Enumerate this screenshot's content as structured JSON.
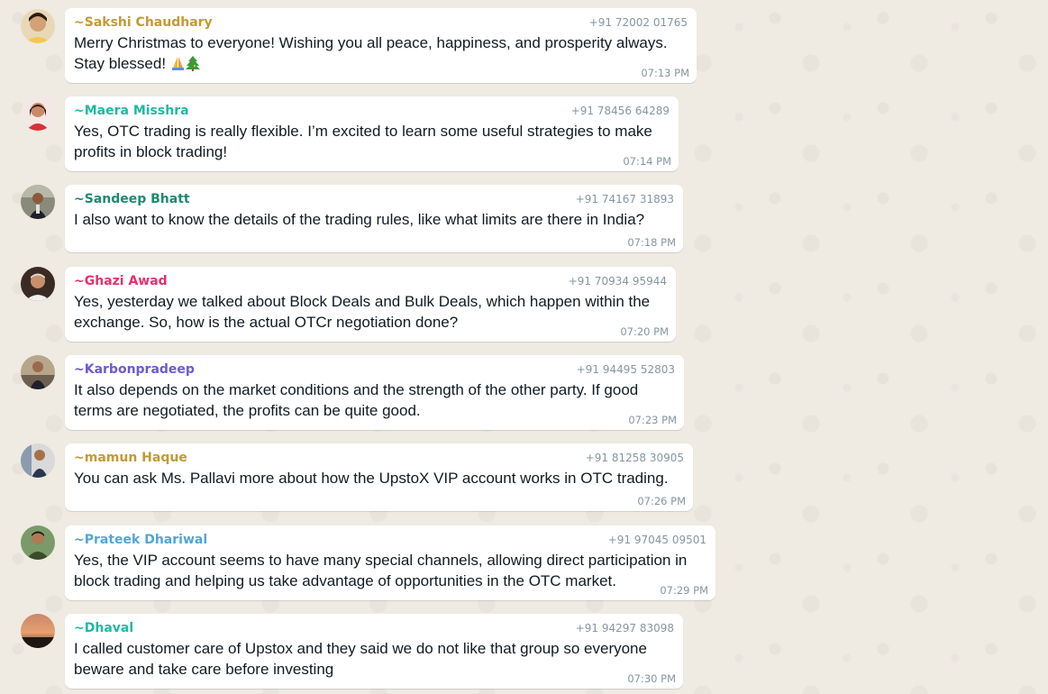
{
  "messages": [
    {
      "sender": "~Sakshi Chaudhary",
      "sender_color": "#c29a36",
      "phone": "+91 72002 01765",
      "lines": [
        "Merry Christmas to everyone! Wishing you all peace, happiness, and prosperity always.",
        "Stay blessed! "
      ],
      "emojis": [
        "folded-hands-icon",
        "christmas-tree-icon"
      ],
      "time": "07:13 PM"
    },
    {
      "sender": "~Maera Misshra",
      "sender_color": "#1fb9a2",
      "phone": "+91 78456 64289",
      "lines": [
        "Yes, OTC trading is really flexible. I’m excited to learn some useful strategies to make",
        "profits in block trading!"
      ],
      "time": "07:14 PM"
    },
    {
      "sender": "~Sandeep Bhatt",
      "sender_color": "#1d8a6e",
      "phone": "+91 74167 31893",
      "lines": [
        "I also want to know the details of the trading rules, like what limits are there in India?"
      ],
      "time": "07:18 PM"
    },
    {
      "sender": "~Ghazi Awad",
      "sender_color": "#e5306f",
      "phone": "+91 70934 95944",
      "lines": [
        "Yes, yesterday we talked about Block Deals and Bulk Deals, which happen within the",
        "exchange. So, how is the actual OTCr negotiation done?"
      ],
      "time": "07:20 PM"
    },
    {
      "sender": "~Karbonpradeep",
      "sender_color": "#6b5ad4",
      "phone": "+91 94495 52803",
      "lines": [
        "It also depends on the market conditions and the strength of the other party. If good",
        "terms are negotiated, the profits can be quite good."
      ],
      "time": "07:23 PM"
    },
    {
      "sender": "~mamun Haque",
      "sender_color": "#c29a36",
      "phone": "+91 81258 30905",
      "lines": [
        "You can ask Ms. Pallavi more about how the UpstoX VIP account works in OTC trading."
      ],
      "time": "07:26 PM"
    },
    {
      "sender": "~Prateek Dhariwal",
      "sender_color": "#53a5d6",
      "phone": "+91 97045 09501",
      "lines": [
        "Yes, the VIP account seems to have many special channels, allowing direct participation in",
        "block trading and helping us take advantage of opportunities in the OTC market."
      ],
      "time": "07:29 PM"
    },
    {
      "sender": "~Dhaval",
      "sender_color": "#1fb9a2",
      "phone": "+91 94297 83098",
      "lines": [
        "I called customer care of Upstox and they said we do not like that group so everyone",
        "beware and take care before investing"
      ],
      "time": "07:30 PM"
    }
  ]
}
